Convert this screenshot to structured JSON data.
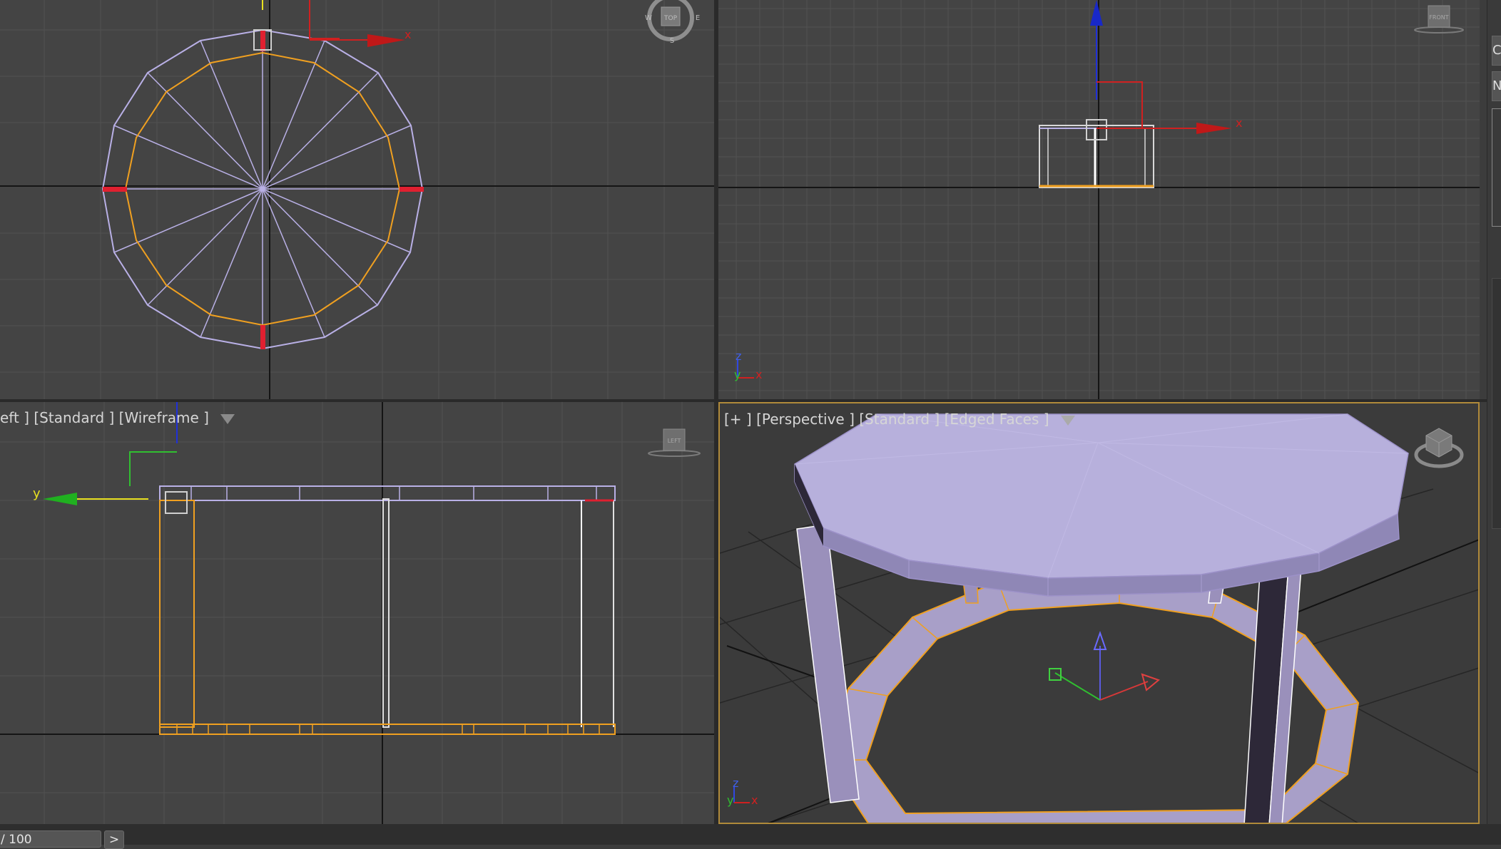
{
  "viewports": {
    "top": {
      "compass": {
        "north_hint": "N",
        "west": "W",
        "east": "E",
        "south": "S",
        "cube_face": "TOP"
      },
      "axis_x": "x"
    },
    "front": {
      "cube_face": "FRONT",
      "axis_x": "x",
      "tripod": {
        "z": "z",
        "y": "y",
        "x": "x"
      }
    },
    "left": {
      "label": {
        "view": "eft ]",
        "shading": "[Standard ]",
        "mode": "[Wireframe ]"
      },
      "cube_face": "LEFT",
      "axis_y": "y"
    },
    "perspective": {
      "label": {
        "plus": "[+ ]",
        "view": "[Perspective ]",
        "shading": "[Standard ]",
        "mode": "[Edged Faces ]"
      },
      "tripod": {
        "z": "z",
        "y": "y",
        "x": "x"
      }
    }
  },
  "command_panel": {
    "tab1": "C",
    "tab2": "N"
  },
  "timeline": {
    "frame_readout": "/ 100",
    "next_button": ">"
  },
  "colors": {
    "viewport_bg": "#444444",
    "grid": "#525252",
    "wire_lavender": "#b9b0e6",
    "wire_orange": "#f0a020",
    "selection_red": "#e02030",
    "active_border": "#b08a3a"
  }
}
